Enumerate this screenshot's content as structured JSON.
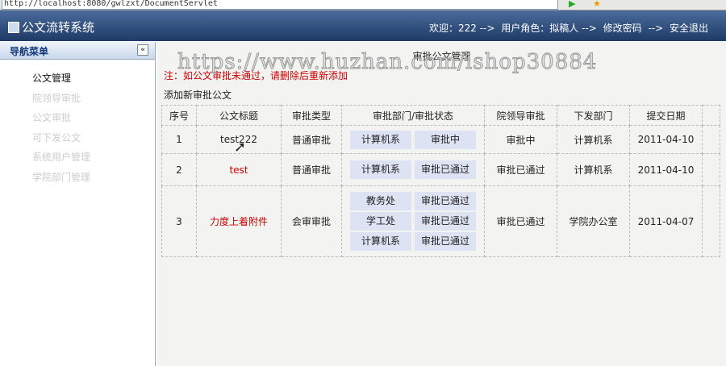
{
  "browser": {
    "url": "http://localhost:8080/gwlzxt/DocumentServlet"
  },
  "header": {
    "title": "公文流转系统",
    "welcome": "欢迎：222 -->",
    "role": "用户角色：拟稿人 -->",
    "change_password": "修改密码",
    "arrow": "-->",
    "logout": "安全退出"
  },
  "sidebar": {
    "title": "导航菜单",
    "collapse": "«",
    "items": [
      {
        "label": "公文管理"
      },
      {
        "label": "院领导审批"
      },
      {
        "label": "公文审批"
      },
      {
        "label": "可下发公文"
      },
      {
        "label": "系统用户管理"
      },
      {
        "label": "学院部门管理"
      }
    ]
  },
  "main": {
    "title": "审批公文管理",
    "note": "注：如公文审批未通过，请删除后重新添加",
    "add_link": "添加新审批公文",
    "watermark": "https://www.huzhan.com/ishop30884",
    "columns": [
      "序号",
      "公文标题",
      "审批类型",
      "审批部门/审批状态",
      "院领导审批",
      "下发部门",
      "提交日期"
    ],
    "rows": [
      {
        "no": "1",
        "title": "test222",
        "type": "普通审批",
        "depts": [
          [
            "计算机系",
            "审批中"
          ]
        ],
        "leader": "审批中",
        "issue": "计算机系",
        "date": "2011-04-10"
      },
      {
        "no": "2",
        "title": "test",
        "type": "普通审批",
        "depts": [
          [
            "计算机系",
            "审批已通过"
          ]
        ],
        "leader": "审批已通过",
        "issue": "计算机系",
        "date": "2011-04-10"
      },
      {
        "no": "3",
        "title": "力度上着附件",
        "type": "会审审批",
        "depts": [
          [
            "教务处",
            "审批已通过"
          ],
          [
            "学工处",
            "审批已通过"
          ],
          [
            "计算机系",
            "审批已通过"
          ]
        ],
        "leader": "审批已通过",
        "issue": "学院办公室",
        "date": "2011-04-07"
      }
    ]
  }
}
